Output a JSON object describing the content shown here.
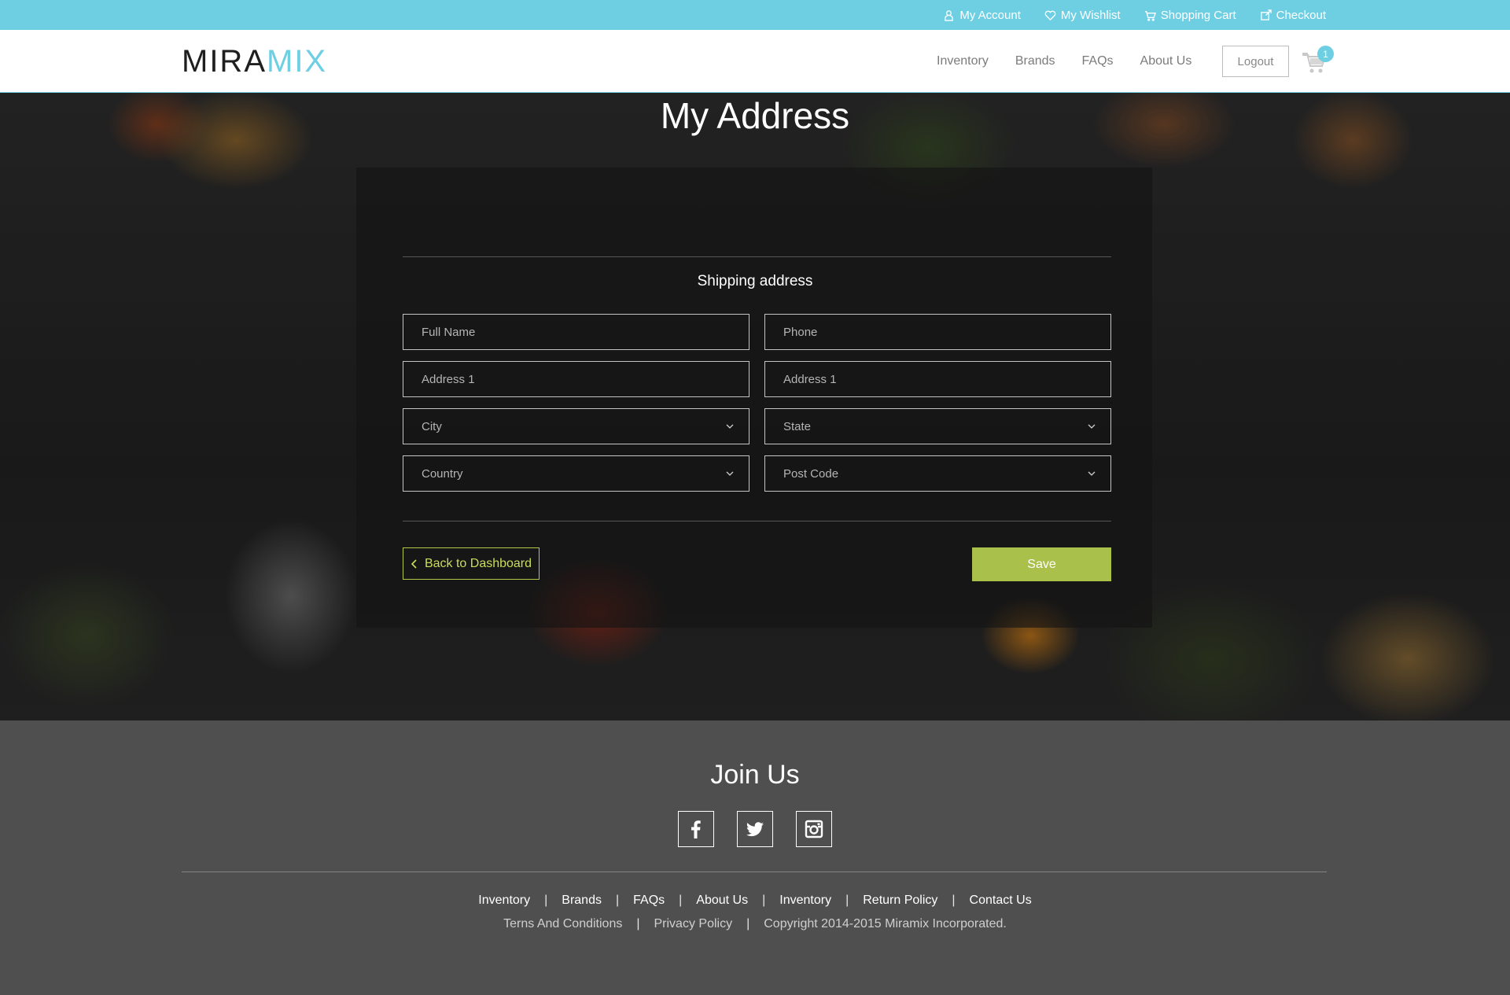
{
  "topbar": {
    "links": [
      {
        "label": "My Account",
        "icon": "user-icon"
      },
      {
        "label": "My Wishlist",
        "icon": "heart-icon"
      },
      {
        "label": "Shopping Cart",
        "icon": "cart-icon"
      },
      {
        "label": "Checkout",
        "icon": "checkout-icon"
      }
    ]
  },
  "header": {
    "logo_part1": "MIRA",
    "logo_part2": "MIX",
    "nav": [
      "Inventory",
      "Brands",
      "FAQs",
      "About Us"
    ],
    "logout_label": "Logout",
    "cart_count": "1"
  },
  "main": {
    "title": "My Address",
    "subtitle": "Shipping address",
    "fields": {
      "full_name": {
        "placeholder": "Full Name",
        "value": ""
      },
      "phone": {
        "placeholder": "Phone",
        "value": ""
      },
      "address1": {
        "placeholder": "Address 1",
        "value": ""
      },
      "address2": {
        "placeholder": "Address 1",
        "value": ""
      },
      "city": {
        "placeholder": "City",
        "value": ""
      },
      "state": {
        "placeholder": "State",
        "value": ""
      },
      "country": {
        "placeholder": "Country",
        "value": ""
      },
      "post_code": {
        "placeholder": "Post Code",
        "value": ""
      }
    },
    "back_label": "Back to Dashboard",
    "save_label": "Save"
  },
  "footer": {
    "join_label": "Join Us",
    "social": [
      "facebook-icon",
      "twitter-icon",
      "instagram-icon"
    ],
    "links_row1": [
      "Inventory",
      "Brands",
      "FAQs",
      "About Us",
      "Inventory",
      "Return Policy",
      "Contact Us"
    ],
    "links_row2": [
      "Terns And Conditions",
      "Privacy Policy"
    ],
    "copyright": "Copyright 2014-2015 Miramix Incorporated."
  },
  "colors": {
    "accent_blue": "#6ecfe3",
    "accent_green": "#a9c04a",
    "footer_bg": "#4f4f4f"
  }
}
